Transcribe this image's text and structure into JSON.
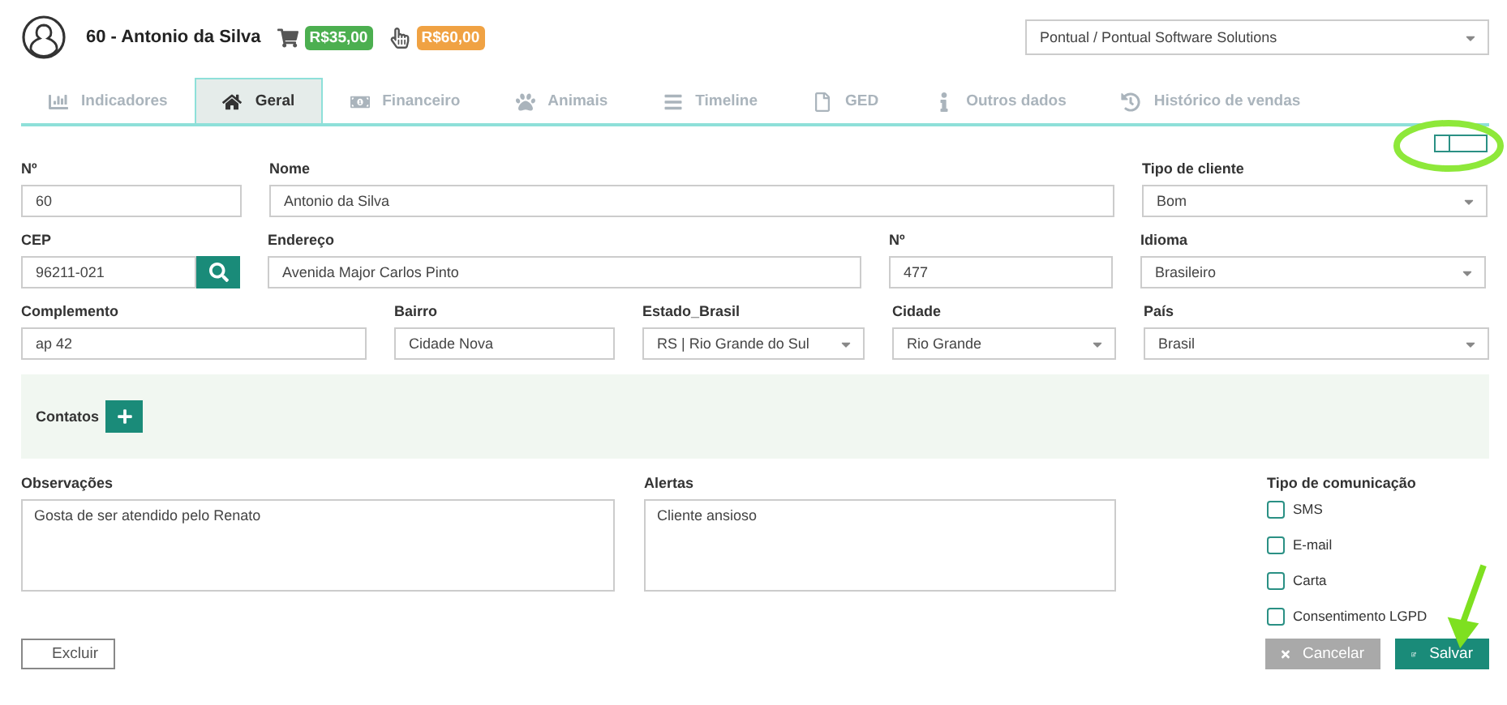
{
  "header": {
    "customer": "60 - Antonio da Silva",
    "badges": [
      {
        "text": "R$35,00",
        "color": "#4caf50"
      },
      {
        "text": "R$60,00",
        "color": "#f0a243"
      }
    ],
    "company": "Pontual / Pontual Software Solutions"
  },
  "tabs": [
    {
      "label": "Indicadores",
      "selected": false
    },
    {
      "label": "Geral",
      "selected": true
    },
    {
      "label": "Financeiro",
      "selected": false
    },
    {
      "label": "Animais",
      "selected": false
    },
    {
      "label": "Timeline",
      "selected": false
    },
    {
      "label": "GED",
      "selected": false
    },
    {
      "label": "Outros dados",
      "selected": false
    },
    {
      "label": "Histórico de vendas",
      "selected": false
    }
  ],
  "form_rows": [
    [
      {
        "label": "Nº",
        "value": "60",
        "kind": "text"
      },
      {
        "label": "Nome",
        "value": "Antonio da Silva",
        "kind": "text"
      },
      {
        "label": "Tipo de cliente",
        "value": "Bom",
        "kind": "select"
      }
    ],
    [
      {
        "label": "CEP",
        "value": "96211-021",
        "kind": "search"
      },
      {
        "label": "Endereço",
        "value": "Avenida Major Carlos Pinto",
        "kind": "text"
      },
      {
        "label": "Nº",
        "value": "477",
        "kind": "text"
      },
      {
        "label": "Idioma",
        "value": "Brasileiro",
        "kind": "select"
      }
    ],
    [
      {
        "label": "Complemento",
        "value": "ap 42",
        "kind": "text"
      },
      {
        "label": "Bairro",
        "value": "Cidade Nova",
        "kind": "text"
      },
      {
        "label": "Estado_Brasil",
        "value": "RS | Rio Grande do Sul",
        "kind": "select"
      },
      {
        "label": "Cidade",
        "value": "Rio Grande",
        "kind": "select"
      },
      {
        "label": "País",
        "value": "Brasil",
        "kind": "select"
      }
    ]
  ],
  "contacts": {
    "label": "Contatos"
  },
  "notes": [
    {
      "label": "Observações",
      "value": "Gosta de ser atendido pelo Renato"
    },
    {
      "label": "Alertas",
      "value": "Cliente ansioso"
    }
  ],
  "communication": {
    "label": "Tipo de comunicação",
    "options": [
      {
        "label": "SMS",
        "checked": false
      },
      {
        "label": "E-mail",
        "checked": false
      },
      {
        "label": "Carta",
        "checked": false
      },
      {
        "label": "Consentimento LGPD",
        "checked": false
      }
    ]
  },
  "buttons": [
    {
      "label": "Excluir",
      "kind": "delete",
      "disabled": false
    },
    {
      "label": "Cancelar",
      "kind": "cancel",
      "disabled": true
    },
    {
      "label": "Salvar",
      "kind": "save",
      "disabled": false
    }
  ]
}
